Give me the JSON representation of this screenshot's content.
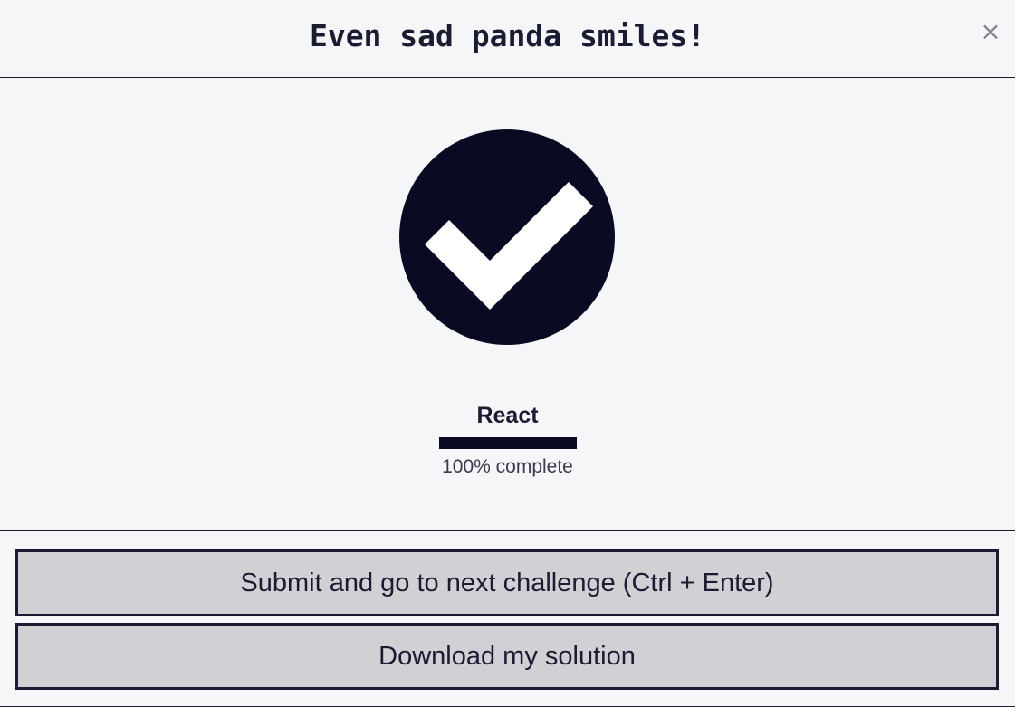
{
  "modal": {
    "title": "Even sad panda smiles!",
    "close_label": "×"
  },
  "completion": {
    "icon": "check-circle-icon",
    "certification": "React",
    "progress_fraction": 1.0,
    "progress_text": "100% complete"
  },
  "actions": {
    "submit_label": "Submit and go to next challenge (Ctrl + Enter)",
    "download_label": "Download my solution"
  },
  "colors": {
    "background": "#f5f6f7",
    "dark": "#0a0a23",
    "text": "#1b1b32",
    "button_bg": "#d0d0d5",
    "close_icon": "#858591"
  }
}
